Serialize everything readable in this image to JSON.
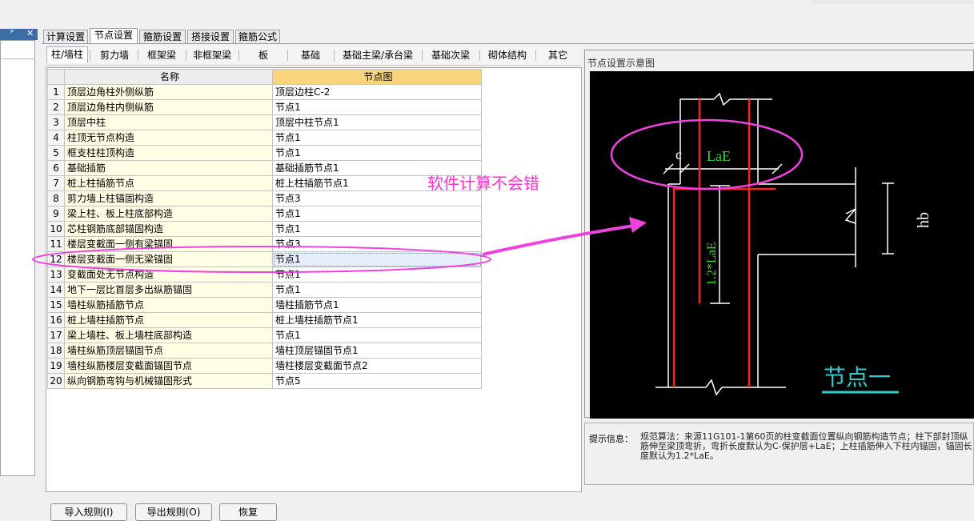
{
  "toolbar": {
    "redo_glyph": "↷",
    "dropdown_glyph": "▾"
  },
  "dock": {
    "pin_glyph": "ᴾ",
    "close_glyph": "✕"
  },
  "tabs": [
    {
      "label": "计算设置"
    },
    {
      "label": "节点设置"
    },
    {
      "label": "箍筋设置"
    },
    {
      "label": "搭接设置"
    },
    {
      "label": "箍筋公式"
    }
  ],
  "subtabs": [
    {
      "label": "柱/墙柱"
    },
    {
      "label": "剪力墙"
    },
    {
      "label": "框架梁"
    },
    {
      "label": "非框架梁"
    },
    {
      "label": "板"
    },
    {
      "label": "基础"
    },
    {
      "label": "基础主梁/承台梁"
    },
    {
      "label": "基础次梁"
    },
    {
      "label": "砌体结构"
    },
    {
      "label": "其它"
    }
  ],
  "grid": {
    "header": {
      "name": "名称",
      "value": "节点图"
    },
    "rows": [
      {
        "num": "1",
        "name": "顶层边角柱外侧纵筋",
        "value": "顶层边柱C-2"
      },
      {
        "num": "2",
        "name": "顶层边角柱内侧纵筋",
        "value": "节点1"
      },
      {
        "num": "3",
        "name": "顶层中柱",
        "value": "顶层中柱节点1"
      },
      {
        "num": "4",
        "name": "柱顶无节点构造",
        "value": "节点1"
      },
      {
        "num": "5",
        "name": "框支柱柱顶构造",
        "value": "节点1"
      },
      {
        "num": "6",
        "name": "基础插筋",
        "value": "基础插筋节点1"
      },
      {
        "num": "7",
        "name": "桩上柱插筋节点",
        "value": "桩上柱插筋节点1"
      },
      {
        "num": "8",
        "name": "剪力墙上柱锚固构造",
        "value": "节点3"
      },
      {
        "num": "9",
        "name": "梁上柱、板上柱底部构造",
        "value": "节点1"
      },
      {
        "num": "10",
        "name": "芯柱钢筋底部锚固构造",
        "value": "节点1"
      },
      {
        "num": "11",
        "name": "楼层变截面一侧有梁锚固",
        "value": "节点3"
      },
      {
        "num": "12",
        "name": "楼层变截面一侧无梁锚固",
        "value": "节点1"
      },
      {
        "num": "13",
        "name": "变截面处无节点构造",
        "value": "节点1"
      },
      {
        "num": "14",
        "name": "地下一层比首层多出纵筋锚固",
        "value": "节点1"
      },
      {
        "num": "15",
        "name": "墙柱纵筋插筋节点",
        "value": "墙柱插筋节点1"
      },
      {
        "num": "16",
        "name": "桩上墙柱插筋节点",
        "value": "桩上墙柱插筋节点1"
      },
      {
        "num": "17",
        "name": "梁上墙柱、板上墙柱底部构造",
        "value": "节点1"
      },
      {
        "num": "18",
        "name": "墙柱纵筋顶层锚固节点",
        "value": "墙柱顶层锚固节点1"
      },
      {
        "num": "19",
        "name": "墙柱纵筋楼层变截面锚固节点",
        "value": "墙柱楼层变截面节点2"
      },
      {
        "num": "20",
        "name": "纵向钢筋弯钩与机械锚固形式",
        "value": "节点5"
      }
    ]
  },
  "diagram": {
    "panel_title": "节点设置示意图",
    "label_c": "c",
    "label_lae": "LaE",
    "label_vertical": "1.2*LaE",
    "label_hb": "hb",
    "caption": "节点一"
  },
  "annotation": {
    "text": "软件计算不会错"
  },
  "hint": {
    "label": "提示信息：",
    "text": "规范算法：来源11G101-1第60页的柱变截面位置纵向钢筋构造节点；柱下部封顶纵筋伸至梁顶弯折，弯折长度默认为C-保护层+LaE；上柱插筋伸入下柱内锚固，锚固长度默认为1.2*LaE。"
  },
  "buttons": [
    {
      "label": "导入规则(I)"
    },
    {
      "label": "导出规则(O)"
    },
    {
      "label": "恢复"
    }
  ],
  "colors": {
    "annotation": "#ff33cc",
    "rebar": "#ff2020",
    "dim_text": "#33dd33",
    "caption": "#33cccc",
    "header_highlight": "#f8d47c"
  }
}
